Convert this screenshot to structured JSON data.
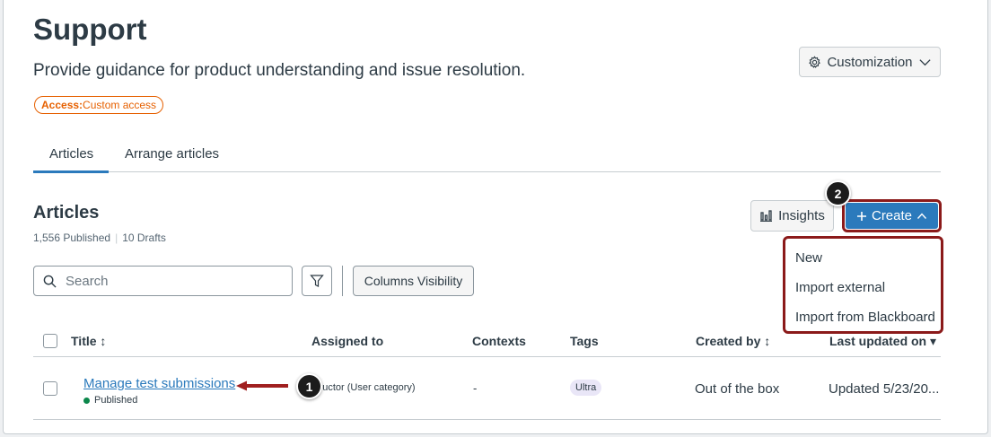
{
  "header": {
    "title": "Support",
    "subtitle": "Provide guidance for product understanding and issue resolution.",
    "access_label": "Access:",
    "access_value": "Custom access",
    "customization_label": "Customization"
  },
  "tabs": [
    {
      "label": "Articles",
      "active": true
    },
    {
      "label": "Arrange articles",
      "active": false
    }
  ],
  "articles_section": {
    "title": "Articles",
    "published_count": "1,556 Published",
    "drafts_count": "10 Drafts",
    "insights_label": "Insights",
    "create_label": "Create"
  },
  "create_menu": {
    "items": [
      "New",
      "Import external",
      "Import from Blackboard"
    ]
  },
  "toolbar": {
    "search_placeholder": "Search",
    "columns_label": "Columns Visibility"
  },
  "table": {
    "columns": [
      "Title ↕",
      "Assigned to",
      "Contexts",
      "Tags",
      "Created by ↕",
      "Last updated on ▾"
    ],
    "rows": [
      {
        "title": "Manage test submissions",
        "status": "Published",
        "assigned_to": "structor (User category)",
        "contexts": "-",
        "tag": "Ultra",
        "created_by": "Out of the box",
        "last_updated": "Updated 5/23/20..."
      }
    ]
  },
  "callouts": [
    "1",
    "2"
  ],
  "colors": {
    "brand_blue": "#2b7abc",
    "highlight_red": "#8b1a1a",
    "access_orange": "#e66000",
    "published_green": "#0b874b"
  },
  "icons": {
    "customization": "gear-icon",
    "insights": "bar-chart-icon",
    "create": "plus-icon",
    "search": "search-icon",
    "filter": "filter-icon"
  }
}
